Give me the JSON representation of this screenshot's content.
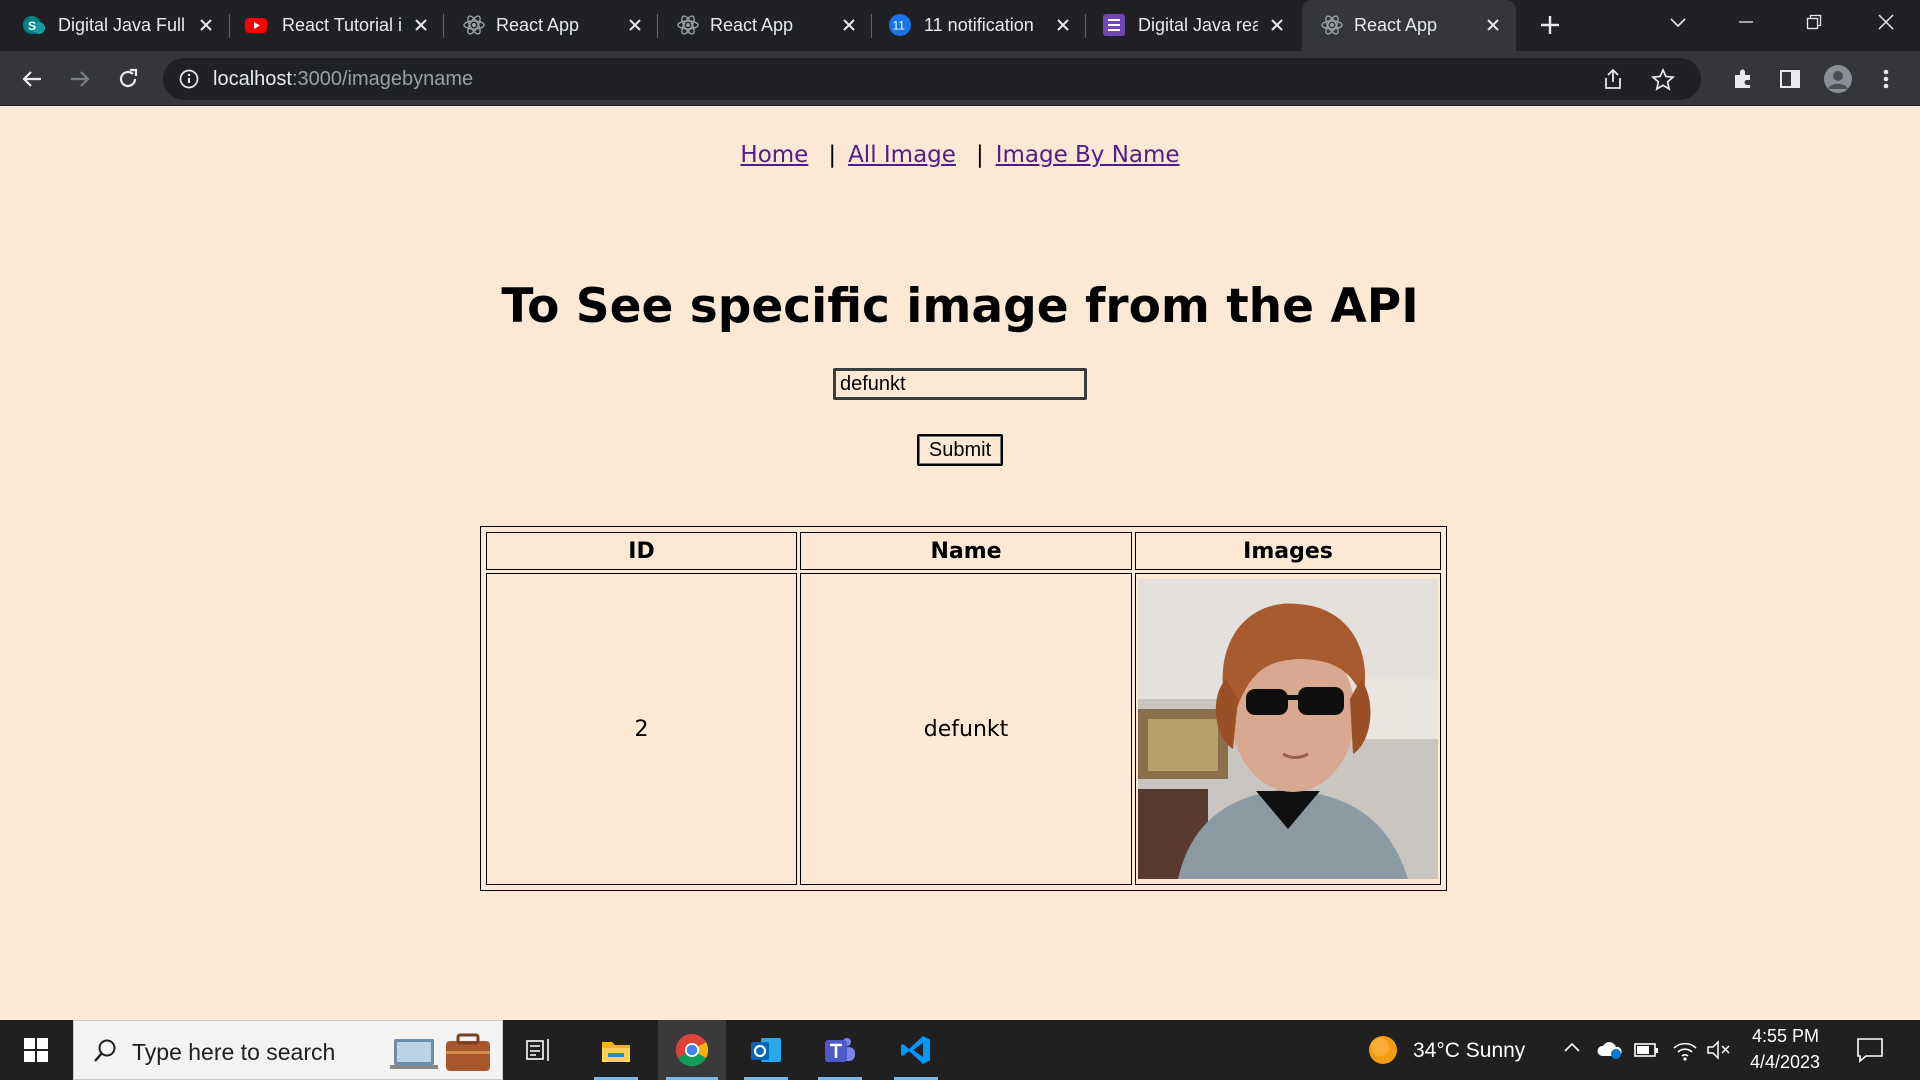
{
  "browser": {
    "tabs": [
      {
        "title": "Digital Java Full",
        "favicon": "sharepoint-icon",
        "active": false
      },
      {
        "title": "React Tutorial i",
        "favicon": "youtube-icon",
        "active": false
      },
      {
        "title": "React App",
        "favicon": "react-icon",
        "active": false
      },
      {
        "title": "React App",
        "favicon": "react-icon",
        "active": false
      },
      {
        "title": "11 notification",
        "favicon": "notification-badge-icon",
        "badge": "11",
        "active": false
      },
      {
        "title": "Digital Java rea",
        "favicon": "forms-icon",
        "active": false
      },
      {
        "title": "React App",
        "favicon": "react-icon",
        "active": true
      }
    ],
    "url_host": "localhost",
    "url_rest": ":3000/imagebyname"
  },
  "page": {
    "nav": {
      "home": "Home",
      "all_image": "All Image",
      "image_by_name": "Image By Name",
      "separator": "|"
    },
    "heading": "To See specific image from the API",
    "search_value": "defunkt",
    "submit_label": "Submit",
    "table": {
      "headers": [
        "ID",
        "Name",
        "Images"
      ],
      "rows": [
        {
          "id": "2",
          "name": "defunkt",
          "image": "profile-photo"
        }
      ]
    }
  },
  "taskbar": {
    "search_placeholder": "Type here to search",
    "weather": "34°C  Sunny",
    "time": "4:55 PM",
    "date": "4/4/2023"
  },
  "colors": {
    "page_bg": "#fbe9d5",
    "link": "#551a8b",
    "tab_bg": "#202124",
    "toolbar_bg": "#35363a"
  }
}
